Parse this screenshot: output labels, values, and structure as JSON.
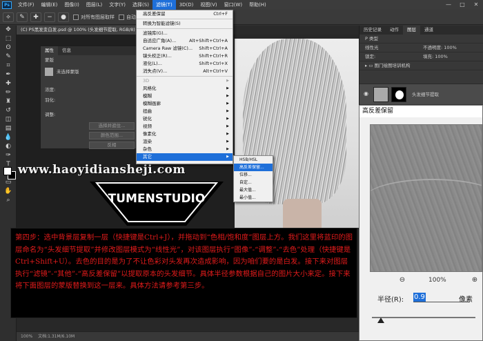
{
  "app": {
    "logo": "Ps"
  },
  "menubar": {
    "items": [
      "文件(F)",
      "编辑(E)",
      "图像(I)",
      "图层(L)",
      "文字(Y)",
      "选择(S)",
      "滤镜(T)",
      "3D(D)",
      "视图(V)",
      "窗口(W)",
      "帮助(H)"
    ],
    "active_index": 6,
    "window_controls": [
      "—",
      "□",
      "✕"
    ]
  },
  "options_bar": {
    "checkbox1_label": "对所有图层取样",
    "checkbox2_label": "自动增强"
  },
  "document_tab": {
    "title": "(C) PS黑发变白发.psd @ 100% (头发细节提取, RGB/8) *"
  },
  "status_bar": {
    "zoom": "100%",
    "doc_info": "文档:1.31M/6.10M"
  },
  "properties_panel": {
    "tabs": [
      "属性",
      "信息"
    ],
    "header": "蒙版",
    "mask_label": "未选择蒙版",
    "density_label": "浓度:",
    "feather_label": "羽化:",
    "adjust_label": "调整:",
    "buttons": [
      "选择并遮住...",
      "颜色范围...",
      "反相"
    ]
  },
  "filter_menu": {
    "items": [
      {
        "label": "高反差保留",
        "shortcut": "Ctrl+F",
        "type": "item"
      },
      {
        "type": "sep"
      },
      {
        "label": "转换为智能滤镜(S)",
        "shortcut": "",
        "type": "item"
      },
      {
        "type": "sep"
      },
      {
        "label": "滤镜库(G)...",
        "shortcut": "",
        "type": "item"
      },
      {
        "label": "自适应广角(A)...",
        "shortcut": "Alt+Shift+Ctrl+A",
        "type": "item"
      },
      {
        "label": "Camera Raw 滤镜(C)...",
        "shortcut": "Shift+Ctrl+A",
        "type": "item"
      },
      {
        "label": "镜头校正(R)...",
        "shortcut": "Shift+Ctrl+R",
        "type": "item"
      },
      {
        "label": "液化(L)...",
        "shortcut": "Shift+Ctrl+X",
        "type": "item"
      },
      {
        "label": "消失点(V)...",
        "shortcut": "Alt+Ctrl+V",
        "type": "item"
      },
      {
        "type": "sep"
      },
      {
        "label": "3D",
        "shortcut": "",
        "type": "disabled"
      },
      {
        "label": "风格化",
        "shortcut": "",
        "type": "sub"
      },
      {
        "label": "模糊",
        "shortcut": "",
        "type": "sub"
      },
      {
        "label": "模糊画廊",
        "shortcut": "",
        "type": "sub"
      },
      {
        "label": "扭曲",
        "shortcut": "",
        "type": "sub"
      },
      {
        "label": "锐化",
        "shortcut": "",
        "type": "sub"
      },
      {
        "label": "视频",
        "shortcut": "",
        "type": "sub"
      },
      {
        "label": "像素化",
        "shortcut": "",
        "type": "sub"
      },
      {
        "label": "渲染",
        "shortcut": "",
        "type": "sub"
      },
      {
        "label": "杂色",
        "shortcut": "",
        "type": "sub"
      },
      {
        "label": "其它",
        "shortcut": "",
        "type": "active"
      }
    ]
  },
  "submenu": {
    "items": [
      "HSB/HSL",
      "高反差保留...",
      "位移...",
      "自定...",
      "最大值...",
      "最小值..."
    ],
    "active_index": 1
  },
  "right_panel": {
    "tabs": [
      "历史记录",
      "动作",
      "图层",
      "通道"
    ],
    "active_tab": 2,
    "kind_label": "P 类型",
    "blend_mode": "线性光",
    "opacity_label": "不透明度: 100%",
    "lock_label": "锁定:",
    "fill_label": "填充: 100%",
    "group_name": "图门绘图培训机构",
    "layer_name": "头发细节提取"
  },
  "watermark": {
    "text": "www.haoyidiansheji.com"
  },
  "logo_text": "TUMENSTUDIO",
  "high_pass": {
    "title": "高反差保留",
    "zoom": "100%",
    "radius_label": "半径(R):",
    "radius_value": "0.9",
    "unit": "像素",
    "slider_fraction": 0.05
  },
  "instructions": {
    "text": "第四步：选中背景层复制一层（快捷键是Ctrl+J），并拖动到“色相/饱和度”图层上方。我们这里将蓝印的图层命名为“头发细节提取”并修改图层模式为“线性光”，对该图层执行“图像”-“调整”-“去色”处理（快捷键是Ctrl+Shift+U）。去色的目的是为了不让色彩对头发再次造成影响，因为咱们要的是白发。接下来对图层执行“滤镜”-“其他”-“高反差保留”以提取原本的头发细节。具体半径参数根据自己的图片大小来定。接下来将下面图层的蒙版替换到这一层来。具体方法请参考第三步。"
  }
}
